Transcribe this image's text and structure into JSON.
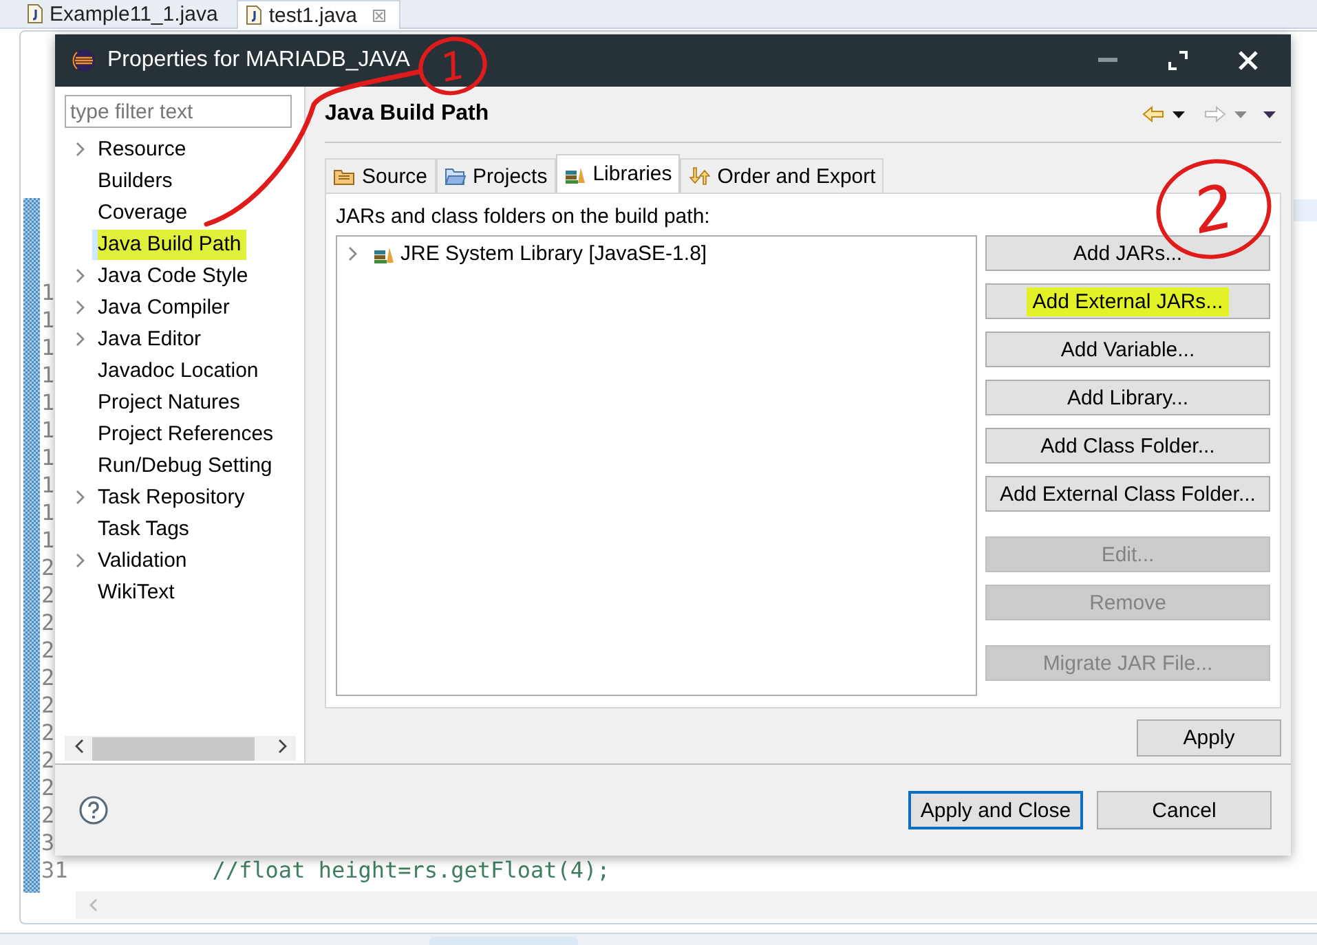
{
  "editor": {
    "tabs": [
      {
        "label": "Example11_1.java",
        "selected": false,
        "closable": false
      },
      {
        "label": "test1.java",
        "selected": true,
        "closable": true
      }
    ],
    "gutter": [
      "1",
      "1",
      "1",
      "1",
      "1",
      "1",
      "1",
      "1",
      "1",
      "1",
      "2",
      "2",
      "2",
      "2",
      "2",
      "2",
      "2",
      "2",
      "2",
      "2",
      "3"
    ],
    "code_line": {
      "number": "31",
      "text": "//float height=rs.getFloat(4);"
    }
  },
  "dialog": {
    "title": "Properties for MARIADB_JAVA",
    "filter": {
      "placeholder": "type filter text"
    },
    "tree": [
      {
        "label": "Resource",
        "expandable": true,
        "selected": false,
        "highlighted": false
      },
      {
        "label": "Builders",
        "expandable": false,
        "selected": false,
        "highlighted": false
      },
      {
        "label": "Coverage",
        "expandable": false,
        "selected": false,
        "highlighted": false
      },
      {
        "label": "Java Build Path",
        "expandable": false,
        "selected": true,
        "highlighted": true
      },
      {
        "label": "Java Code Style",
        "expandable": true,
        "selected": false,
        "highlighted": false
      },
      {
        "label": "Java Compiler",
        "expandable": true,
        "selected": false,
        "highlighted": false
      },
      {
        "label": "Java Editor",
        "expandable": true,
        "selected": false,
        "highlighted": false
      },
      {
        "label": "Javadoc Location",
        "expandable": false,
        "selected": false,
        "highlighted": false
      },
      {
        "label": "Project Natures",
        "expandable": false,
        "selected": false,
        "highlighted": false
      },
      {
        "label": "Project References",
        "expandable": false,
        "selected": false,
        "highlighted": false
      },
      {
        "label": "Run/Debug Setting",
        "expandable": false,
        "selected": false,
        "highlighted": false
      },
      {
        "label": "Task Repository",
        "expandable": true,
        "selected": false,
        "highlighted": false
      },
      {
        "label": "Task Tags",
        "expandable": false,
        "selected": false,
        "highlighted": false
      },
      {
        "label": "Validation",
        "expandable": true,
        "selected": false,
        "highlighted": false
      },
      {
        "label": "WikiText",
        "expandable": false,
        "selected": false,
        "highlighted": false
      }
    ],
    "page_title": "Java Build Path",
    "tabs": [
      {
        "label": "Source",
        "selected": false
      },
      {
        "label": "Projects",
        "selected": false
      },
      {
        "label": "Libraries",
        "selected": true
      },
      {
        "label": "Order and Export",
        "selected": false
      }
    ],
    "list_label": "JARs and class folders on the build path:",
    "entries": [
      {
        "label": "JRE System Library [JavaSE-1.8]",
        "expandable": true
      }
    ],
    "button_groups": [
      [
        {
          "label": "Add JARs...",
          "disabled": false,
          "highlighted": false
        },
        {
          "label": "Add External JARs...",
          "disabled": false,
          "highlighted": true
        },
        {
          "label": "Add Variable...",
          "disabled": false,
          "highlighted": false
        },
        {
          "label": "Add Library...",
          "disabled": false,
          "highlighted": false
        },
        {
          "label": "Add Class Folder...",
          "disabled": false,
          "highlighted": false
        },
        {
          "label": "Add External Class Folder...",
          "disabled": false,
          "highlighted": false
        }
      ],
      [
        {
          "label": "Edit...",
          "disabled": true,
          "highlighted": false
        },
        {
          "label": "Remove",
          "disabled": true,
          "highlighted": false
        }
      ],
      [
        {
          "label": "Migrate JAR File...",
          "disabled": true,
          "highlighted": false
        }
      ]
    ],
    "apply": "Apply",
    "footer_buttons": [
      {
        "label": "Apply and Close",
        "default": true
      },
      {
        "label": "Cancel",
        "default": false
      }
    ]
  },
  "annotations": [
    {
      "label": "1"
    },
    {
      "label": "2"
    }
  ]
}
